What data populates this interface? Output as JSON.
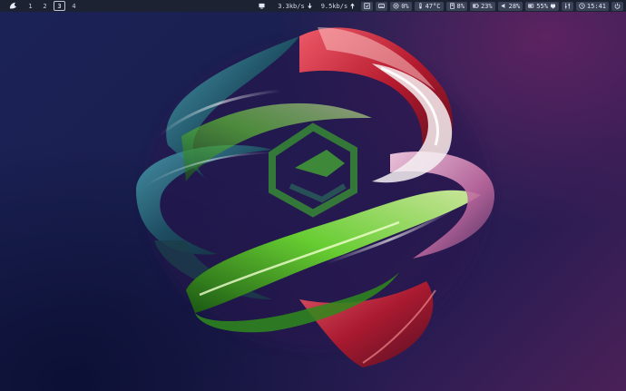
{
  "workspaces": [
    {
      "label": "1",
      "active": false
    },
    {
      "label": "2",
      "active": false
    },
    {
      "label": "3",
      "active": true
    },
    {
      "label": "4",
      "active": false
    }
  ],
  "network": {
    "down": "3.3kb/s",
    "up": "9.5kb/s"
  },
  "modules": {
    "cpu": "0%",
    "temperature": "47°C",
    "memory": "8%",
    "battery": "23%",
    "volume": "28%",
    "backlight": "55%",
    "clock": "15:41"
  },
  "icons": {
    "launcher": "distro-logo-icon",
    "tray": "screen-icon",
    "down": "arrow-down-icon",
    "up": "arrow-up-icon"
  },
  "colors": {
    "bar_bg": "#1d2233",
    "module_bg": "#3a4258",
    "text": "#d5d8e4"
  }
}
